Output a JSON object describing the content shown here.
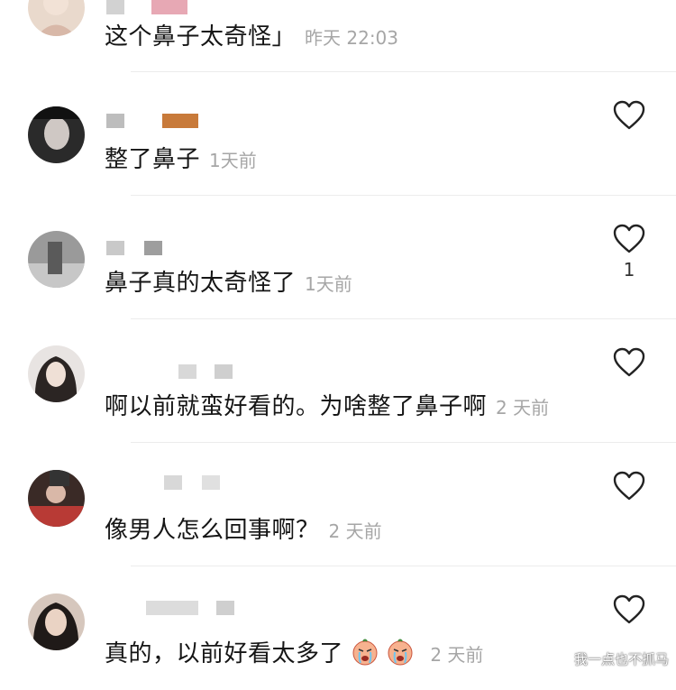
{
  "comments": [
    {
      "text": "这个鼻子太奇怪」",
      "time": "昨天 22:03",
      "likes": "",
      "avatar": "avatar-light"
    },
    {
      "text": "整了鼻子",
      "time": "1天前",
      "likes": "",
      "avatar": "avatar-dark"
    },
    {
      "text": "鼻子真的太奇怪了",
      "time": "1天前",
      "likes": "1",
      "avatar": "avatar-gray"
    },
    {
      "text": "啊以前就蛮好看的。为啥整了鼻子啊",
      "time": "2 天前",
      "likes": "",
      "avatar": "avatar-portrait"
    },
    {
      "text": "像男人怎么回事啊？",
      "time": "2 天前",
      "likes": "",
      "avatar": "avatar-red"
    },
    {
      "text": "真的，以前好看太多了",
      "time": "2 天前",
      "likes": "",
      "avatar": "avatar-portrait-2",
      "emojis": [
        "crying-face-emoji",
        "crying-face-emoji"
      ]
    }
  ],
  "icons": {
    "like": "heart-outline-icon"
  },
  "colors": {
    "text": "#151515",
    "time": "#a6a6a6",
    "divider": "#ececec"
  },
  "watermark": "我一点也不抓马"
}
